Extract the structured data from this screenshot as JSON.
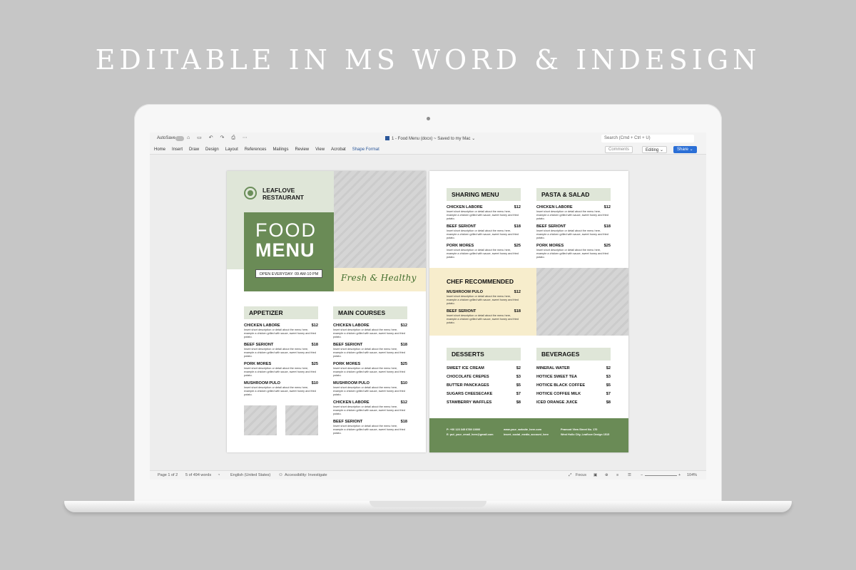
{
  "headline": "EDITABLE IN MS WORD & INDESIGN",
  "word": {
    "titlebar": {
      "autosave": "AutoSave",
      "icons": "⌂ ▭ ↶ ↷ ⎙ ⋯",
      "doc_title": "1 - Food Menu (docx) ~ Saved to my Mac ⌄",
      "search_placeholder": "Search (Cmd + Ctrl + U)"
    },
    "ribbon": {
      "tabs": [
        "Home",
        "Insert",
        "Draw",
        "Design",
        "Layout",
        "References",
        "Mailings",
        "Review",
        "View",
        "Acrobat",
        "Shape Format"
      ],
      "comments": "Comments",
      "editing": "Editing ⌄",
      "share": "Share ⌄"
    },
    "statusbar": {
      "page": "Page 1 of 2",
      "words": "5 of 494 words",
      "language": "English (United States)",
      "accessibility": "Accessibility: Investigate",
      "focus": "Focus",
      "zoom": "104%"
    }
  },
  "menu": {
    "restaurant_line1": "LEAFLOVE",
    "restaurant_line2": "RESTAURANT",
    "title_line1": "FOOD",
    "title_line2": "MENU",
    "open_hours": "OPEN EVERYDAY: 09 AM-10 PM",
    "tagline": "Fresh & Healthy",
    "desc": "Insert short description or detail about the menu here, example a chicken grilled with sauce, sweet honey and fried potato.",
    "appetizer": {
      "title": "APPETIZER",
      "items": [
        {
          "name": "CHICKEN LABORE",
          "price": "$12"
        },
        {
          "name": "BEEF SERIONT",
          "price": "$18"
        },
        {
          "name": "PORK MORES",
          "price": "$25"
        },
        {
          "name": "MUSHROOM PULO",
          "price": "$10"
        }
      ]
    },
    "main_courses": {
      "title": "MAIN COURSES",
      "items": [
        {
          "name": "CHICKEN LABORE",
          "price": "$12"
        },
        {
          "name": "BEEF SERIONT",
          "price": "$18"
        },
        {
          "name": "PORK MORES",
          "price": "$25"
        },
        {
          "name": "MUSHROOM PULO",
          "price": "$10"
        },
        {
          "name": "CHICKEN LABORE",
          "price": "$12"
        },
        {
          "name": "BEEF SERIONT",
          "price": "$18"
        }
      ]
    },
    "sharing_menu": {
      "title": "SHARING MENU",
      "items": [
        {
          "name": "CHICKEN LABORE",
          "price": "$12"
        },
        {
          "name": "BEEF SERIONT",
          "price": "$18"
        },
        {
          "name": "PORK MORES",
          "price": "$25"
        }
      ]
    },
    "pasta_salad": {
      "title": "PASTA & SALAD",
      "items": [
        {
          "name": "CHICKEN LABORE",
          "price": "$12"
        },
        {
          "name": "BEEF SERIONT",
          "price": "$18"
        },
        {
          "name": "PORK MORES",
          "price": "$25"
        }
      ]
    },
    "chef_recommended": {
      "title": "CHEF RECOMMENDED",
      "items": [
        {
          "name": "MUSHROOM PULO",
          "price": "$12"
        },
        {
          "name": "BEEF SERIONT",
          "price": "$18"
        }
      ]
    },
    "desserts": {
      "title": "DESSERTS",
      "items": [
        {
          "name": "SWEET ICE CREAM",
          "price": "$2"
        },
        {
          "name": "CHOCOLATE CREPES",
          "price": "$3"
        },
        {
          "name": "BUTTER PANCKAGES",
          "price": "$5"
        },
        {
          "name": "SUGARS CHEESECAKE",
          "price": "$7"
        },
        {
          "name": "STAWBERRY WAFFLES",
          "price": "$8"
        }
      ]
    },
    "beverages": {
      "title": "BEVERAGES",
      "items": [
        {
          "name": "MINERAL WATER",
          "price": "$2"
        },
        {
          "name": "HOT/ICE SWEET TEA",
          "price": "$3"
        },
        {
          "name": "HOT/ICE BLACK COFFEE",
          "price": "$5"
        },
        {
          "name": "HOT/ICE COFFEE MILK",
          "price": "$7"
        },
        {
          "name": "ICED ORANGE JUICE",
          "price": "$8"
        }
      ]
    },
    "footer": {
      "phone": "P: +00 123 345 6789 10000",
      "email": "E: put_your_email_here@gmail.com",
      "website": "www.your_website_here.com",
      "social": "insert_social_media_account_here",
      "address1": "Pramont View Street No. 170",
      "address2": "West Hollo City, Leaflove Design 1515"
    }
  },
  "colors": {
    "accent_green": "#6a8b56",
    "light_green": "#dfe6d8",
    "cream": "#f7edcc",
    "share_blue": "#2b6fd6"
  }
}
